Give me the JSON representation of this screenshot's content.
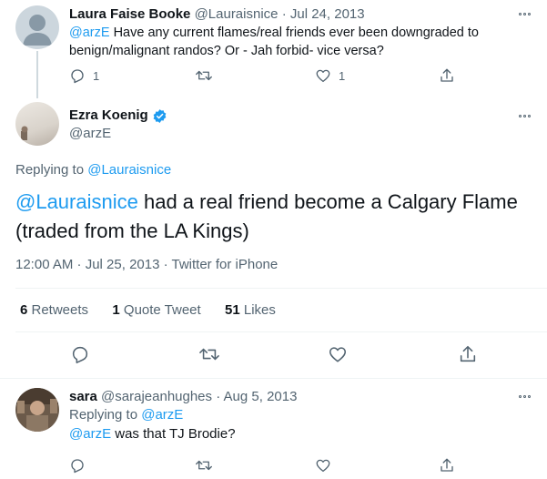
{
  "tweet1": {
    "name": "Laura Faise Booke",
    "handle": "@Lauraisnice",
    "sep": "·",
    "date": "Jul 24, 2013",
    "mention": "@arzE",
    "text_line1": " Have any current flames/real friends ever been downgraded to",
    "text_line2": "benign/malignant randos? Or - Jah forbid- vice versa?",
    "reply_count": "1",
    "like_count": "1"
  },
  "main": {
    "name": "Ezra Koenig",
    "handle": "@arzE",
    "replying_prefix": "Replying to ",
    "replying_handle": "@Lauraisnice",
    "mention": "@Lauraisnice",
    "text_line1_rest": " had a real friend become a Calgary Flame",
    "text_line2": "(traded from the LA Kings)",
    "timestamp": "12:00 AM · Jul 25, 2013 · Twitter for iPhone",
    "retweets_count": "6",
    "retweets_label": " Retweets",
    "quotes_count": "1",
    "quotes_label": " Quote Tweet",
    "likes_count": "51",
    "likes_label": " Likes"
  },
  "tweet3": {
    "name": "sara",
    "handle": "@sarajeanhughes",
    "sep": "·",
    "date": "Aug 5, 2013",
    "replying_prefix": "Replying to ",
    "replying_handle": "@arzE",
    "mention": "@arzE",
    "text_rest": " was that TJ Brodie?"
  },
  "colors": {
    "accent": "#1d9bf0",
    "muted": "#536471",
    "verified": "#1d9bf0"
  },
  "icons": {
    "reply": "reply-icon",
    "retweet": "retweet-icon",
    "like": "heart-icon",
    "share": "share-icon",
    "more": "more-icon",
    "verified": "verified-badge-icon"
  }
}
